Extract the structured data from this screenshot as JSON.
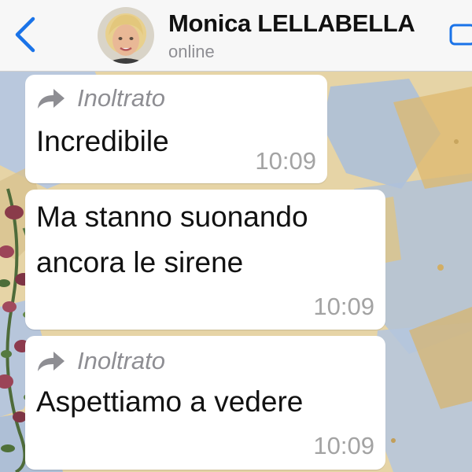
{
  "header": {
    "back_icon": "chevron-left-icon",
    "contact_name": "Monica LELLABELLA",
    "status": "online",
    "right_icon": "video-call-icon",
    "accent_color": "#1a73e8"
  },
  "messages": [
    {
      "forwarded": true,
      "forwarded_label": "Inoltrato",
      "text": "Incredibile",
      "time": "10:09"
    },
    {
      "forwarded": false,
      "lines": [
        "Ma stanno suonando",
        "ancora le sirene"
      ],
      "time": "10:09"
    },
    {
      "forwarded": true,
      "forwarded_label": "Inoltrato",
      "text": "Aspettiamo a vedere",
      "time": "10:09"
    }
  ]
}
